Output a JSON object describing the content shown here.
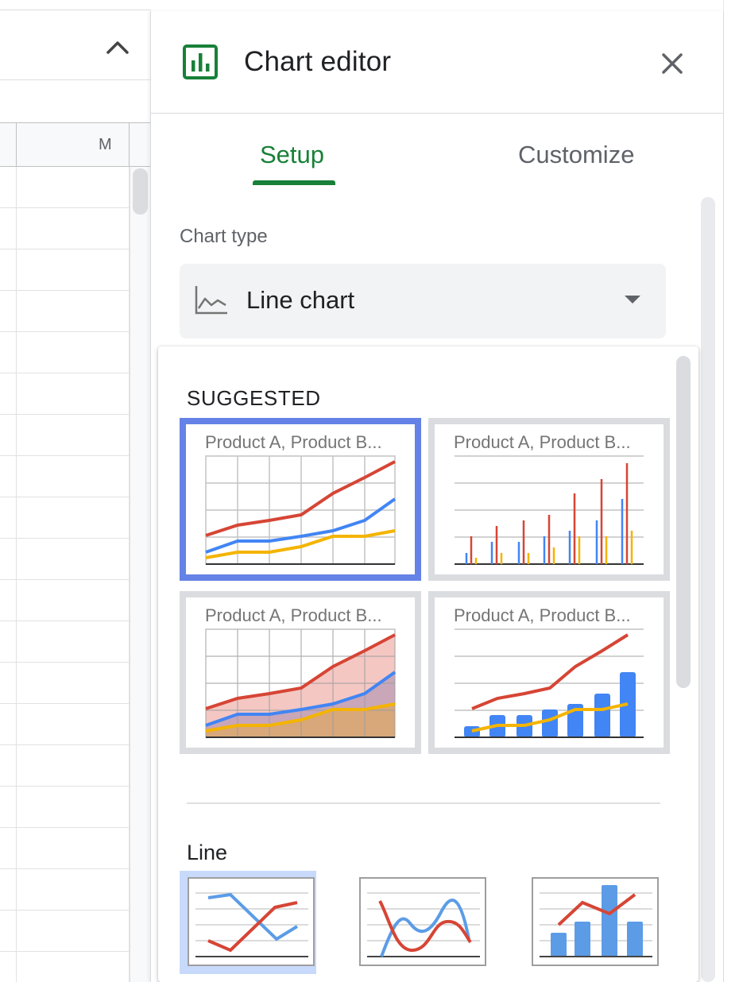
{
  "spreadsheet": {
    "column_header": "M"
  },
  "panel": {
    "title": "Chart editor",
    "tabs": [
      {
        "label": "Setup",
        "active": true
      },
      {
        "label": "Customize",
        "active": false
      }
    ],
    "chart_type": {
      "label": "Chart type",
      "selected": "Line chart"
    },
    "dropdown": {
      "suggested_heading": "SUGGESTED",
      "suggested": [
        {
          "title": "Product A, Product B...",
          "kind": "line",
          "selected": true
        },
        {
          "title": "Product A, Product B...",
          "kind": "column",
          "selected": false
        },
        {
          "title": "Product A, Product B...",
          "kind": "area",
          "selected": false
        },
        {
          "title": "Product A, Product B...",
          "kind": "combo",
          "selected": false
        }
      ],
      "line_heading": "Line",
      "line_options": [
        {
          "name": "line",
          "active": true
        },
        {
          "name": "smooth-line",
          "active": false
        },
        {
          "name": "combo",
          "active": false
        }
      ]
    }
  },
  "colors": {
    "accent_green": "#188038",
    "selected_border": "#6582e6",
    "series_red": "#d64535",
    "series_blue": "#4285f4",
    "series_yellow": "#f4b400"
  }
}
